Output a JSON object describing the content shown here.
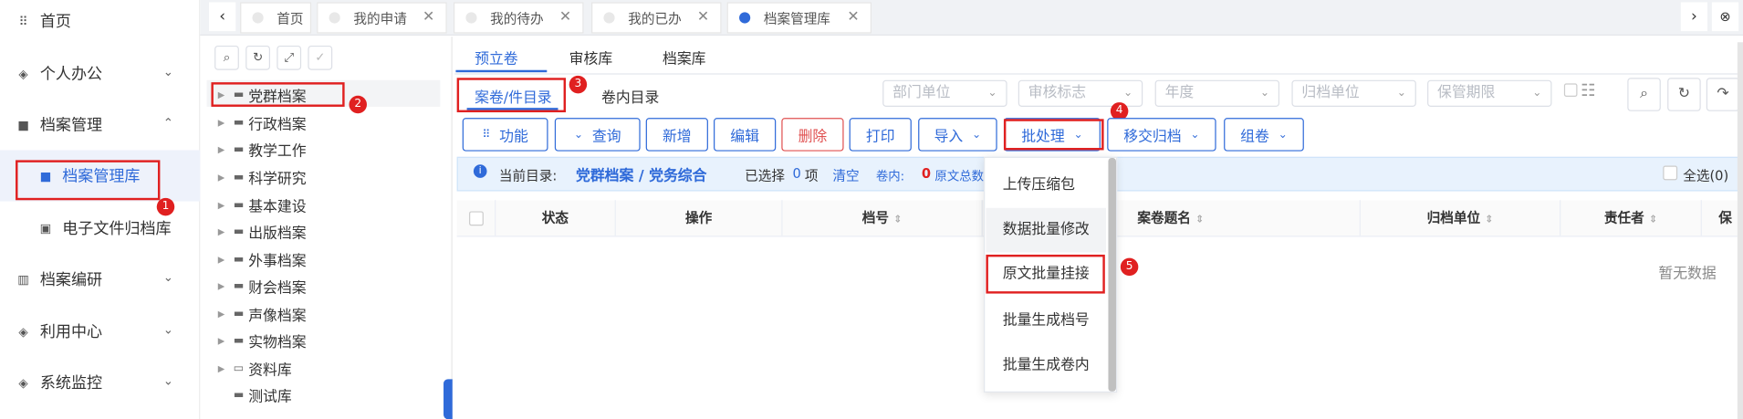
{
  "sidebar": {
    "items": [
      {
        "icon": "grid-icon",
        "label": "首页"
      },
      {
        "icon": "layers-icon",
        "label": "个人办公"
      },
      {
        "icon": "folder-icon",
        "label": "档案管理"
      },
      {
        "icon": "folder-icon",
        "label": "档案管理库"
      },
      {
        "icon": "file-icon",
        "label": "电子文件归档库"
      },
      {
        "icon": "book-icon",
        "label": "档案编研"
      },
      {
        "icon": "layers-icon",
        "label": "利用中心"
      },
      {
        "icon": "layers-icon",
        "label": "系统监控"
      }
    ]
  },
  "tabs": [
    "首页",
    "我的申请",
    "我的待办",
    "我的已办",
    "档案管理库"
  ],
  "tree": {
    "items": [
      "党群档案",
      "行政档案",
      "教学工作",
      "科学研究",
      "基本建设",
      "出版档案",
      "外事档案",
      "财会档案",
      "声像档案",
      "实物档案",
      "资料库",
      "测试库"
    ]
  },
  "main": {
    "tabs": [
      "预立卷",
      "审核库",
      "档案库"
    ],
    "subtabs": [
      "案卷/件目录",
      "卷内目录"
    ],
    "filters": [
      "部门单位",
      "审核标志",
      "年度",
      "归档单位",
      "保管期限"
    ],
    "buttons": [
      "功能",
      "查询",
      "新增",
      "编辑",
      "删除",
      "打印",
      "导入",
      "批处理",
      "移交归档",
      "组卷"
    ],
    "info": {
      "current_label": "当前目录:",
      "path": "党群档案 / 党务综合",
      "selected": "已选择",
      "selected_count": "0",
      "selected_unit": "项",
      "clear": "清空",
      "volume_label": "卷内:",
      "volume_count": "0",
      "original": "原文总数",
      "select_all": "全选(0)"
    },
    "columns": [
      "状态",
      "操作",
      "档号",
      "案卷题名",
      "归档单位",
      "责任者",
      "保管"
    ],
    "empty": "暂无数据"
  },
  "menu": {
    "items": [
      "上传压缩包",
      "数据批量修改",
      "原文批量挂接",
      "批量生成档号",
      "批量生成卷内"
    ]
  },
  "badges": [
    "1",
    "2",
    "3",
    "4",
    "5"
  ],
  "colors": {
    "accent": "#2f6ad9",
    "highlight": "#e02020"
  }
}
